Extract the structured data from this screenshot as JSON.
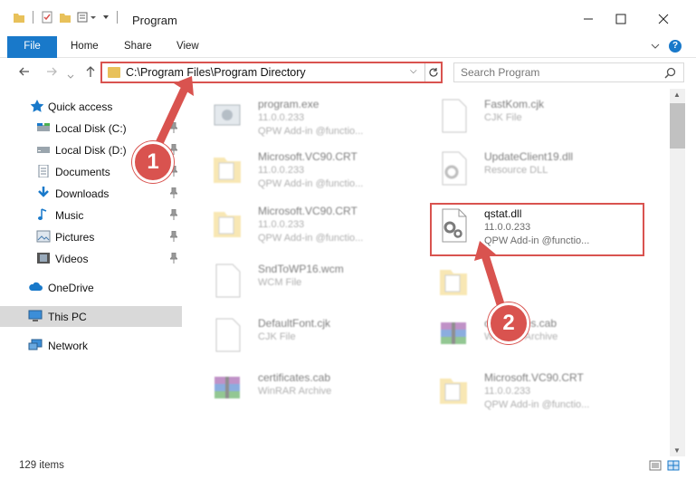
{
  "window": {
    "title": "Program"
  },
  "ribbon": {
    "tabs": [
      "File",
      "Home",
      "Share",
      "View"
    ]
  },
  "address": {
    "path": "C:\\Program Files\\Program Directory"
  },
  "search": {
    "placeholder": "Search Program"
  },
  "sidebar": {
    "items": [
      {
        "label": "Quick access",
        "icon": "star-icon"
      },
      {
        "label": "Local Disk (C:)",
        "icon": "drive-icon"
      },
      {
        "label": "Local Disk (D:)",
        "icon": "drive-icon"
      },
      {
        "label": "Documents",
        "icon": "documents-icon"
      },
      {
        "label": "Downloads",
        "icon": "download-icon"
      },
      {
        "label": "Music",
        "icon": "music-icon"
      },
      {
        "label": "Pictures",
        "icon": "pictures-icon"
      },
      {
        "label": "Videos",
        "icon": "videos-icon"
      },
      {
        "label": "OneDrive",
        "icon": "cloud-icon"
      },
      {
        "label": "This PC",
        "icon": "computer-icon"
      },
      {
        "label": "Network",
        "icon": "network-icon"
      }
    ]
  },
  "files": [
    {
      "name": "program.exe",
      "l2": "11.0.0.233",
      "l3": "QPW Add-in @functio...",
      "icon": "exe-icon"
    },
    {
      "name": "FastKom.cjk",
      "l2": "CJK File",
      "l3": "",
      "icon": "blank-file-icon"
    },
    {
      "name": "Microsoft.VC90.CRT",
      "l2": "11.0.0.233",
      "l3": "QPW Add-in @functio...",
      "icon": "folder-icon"
    },
    {
      "name": "UpdateClient19.dll",
      "l2": "Resource DLL",
      "l3": "",
      "icon": "gear-file-icon"
    },
    {
      "name": "Microsoft.VC90.CRT",
      "l2": "11.0.0.233",
      "l3": "QPW Add-in @functio...",
      "icon": "folder-icon"
    },
    {
      "name": "qstat.dll",
      "l2": "11.0.0.233",
      "l3": "QPW Add-in @functio...",
      "icon": "gear-file-icon"
    },
    {
      "name": "SndToWP16.wcm",
      "l2": "WCM File",
      "l3": "",
      "icon": "blank-file-icon"
    },
    {
      "name": "",
      "l2": "",
      "l3": "",
      "icon": "folder-icon"
    },
    {
      "name": "DefaultFont.cjk",
      "l2": "CJK File",
      "l3": "",
      "icon": "blank-file-icon"
    },
    {
      "name": "certificates.cab",
      "l2": "WinRAR Archive",
      "l3": "",
      "icon": "archive-icon"
    },
    {
      "name": "certificates.cab",
      "l2": "WinRAR Archive",
      "l3": "",
      "icon": "archive-icon"
    },
    {
      "name": "Microsoft.VC90.CRT",
      "l2": "11.0.0.233",
      "l3": "QPW Add-in @functio...",
      "icon": "folder-icon"
    }
  ],
  "status": {
    "count": "129 items"
  },
  "annotations": {
    "marker1": "1",
    "marker2": "2"
  },
  "colors": {
    "accent": "#1979ca",
    "highlight": "#d9534f"
  }
}
